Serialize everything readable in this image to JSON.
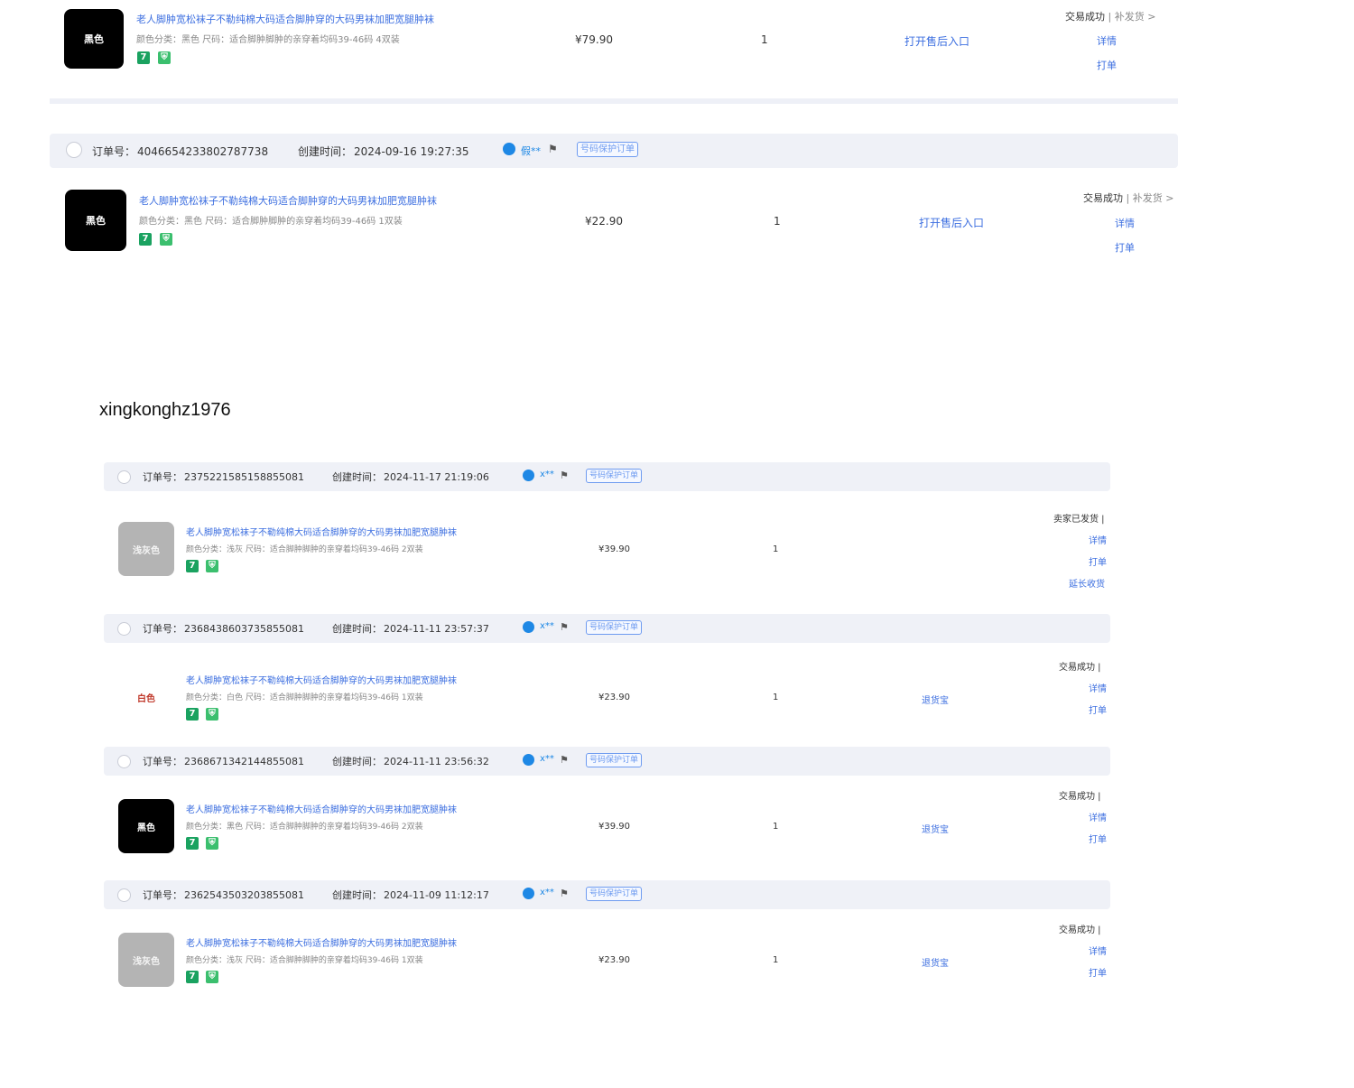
{
  "common": {
    "order_no_label": "订单号：",
    "created_label": "创建时间：",
    "product_title": "老人脚肿宽松袜子不勒纯棉大码适合脚肿穿的大码男袜加肥宽腿肿袜",
    "protection_badge": "号码保护订单",
    "detail": "详情",
    "print": "打单",
    "tag_seven": "7",
    "tag_shield": "⛨",
    "qty": "1",
    "flag_icon": "flag-icon",
    "buyer_icon": "buyer-avatar-icon"
  },
  "top_order": {
    "thumb_label": "黑色",
    "spec": "颜色分类：黑色  尺码：适合脚肿脚肿的亲穿着均码39-46码 4双装",
    "price": "¥79.90",
    "mid_link": "打开售后入口",
    "status": "交易成功",
    "status_extra": "| 补发货 >"
  },
  "order_a": {
    "order_no": "4046654233802787738",
    "created": "2024-09-16 19:27:35",
    "buyer": "假**",
    "thumb_label": "黑色",
    "spec": "颜色分类：黑色  尺码：适合脚肿脚肿的亲穿着均码39-46码 1双装",
    "price": "¥22.90",
    "mid_link": "打开售后入口",
    "status": "交易成功",
    "status_extra": "| 补发货 >"
  },
  "username": "xingkonghz1976",
  "orders": [
    {
      "order_no": "2375221585158855081",
      "created": "2024-11-17 21:19:06",
      "buyer": "x**",
      "thumb_label": "浅灰色",
      "spec": "颜色分类：浅灰  尺码：适合脚肿脚肿的亲穿着均码39-46码 2双装",
      "price": "¥39.90",
      "mid_link": "",
      "status": "卖家已发货 |",
      "actions": [
        "详情",
        "打单",
        "延长收货"
      ]
    },
    {
      "order_no": "2368438603735855081",
      "created": "2024-11-11 23:57:37",
      "buyer": "x**",
      "thumb_label": "白色",
      "spec": "颜色分类：白色  尺码：适合脚肿脚肿的亲穿着均码39-46码 1双装",
      "price": "¥23.90",
      "mid_link": "退货宝",
      "status": "交易成功 |",
      "actions": [
        "详情",
        "打单"
      ]
    },
    {
      "order_no": "2368671342144855081",
      "created": "2024-11-11 23:56:32",
      "buyer": "x**",
      "thumb_label": "黑色",
      "spec": "颜色分类：黑色  尺码：适合脚肿脚肿的亲穿着均码39-46码 2双装",
      "price": "¥39.90",
      "mid_link": "退货宝",
      "status": "交易成功 |",
      "actions": [
        "详情",
        "打单"
      ]
    },
    {
      "order_no": "2362543503203855081",
      "created": "2024-11-09 11:12:17",
      "buyer": "x**",
      "thumb_label": "浅灰色",
      "spec": "颜色分类：浅灰  尺码：适合脚肿脚肿的亲穿着均码39-46码 1双装",
      "price": "¥23.90",
      "mid_link": "退货宝",
      "status": "交易成功 |",
      "actions": [
        "详情",
        "打单"
      ]
    }
  ],
  "colors": {
    "link": "#3d6fe0",
    "header_bg": "#eff1f7",
    "tag_green": "#1aa260",
    "buyer_blue": "#1e88e5"
  }
}
